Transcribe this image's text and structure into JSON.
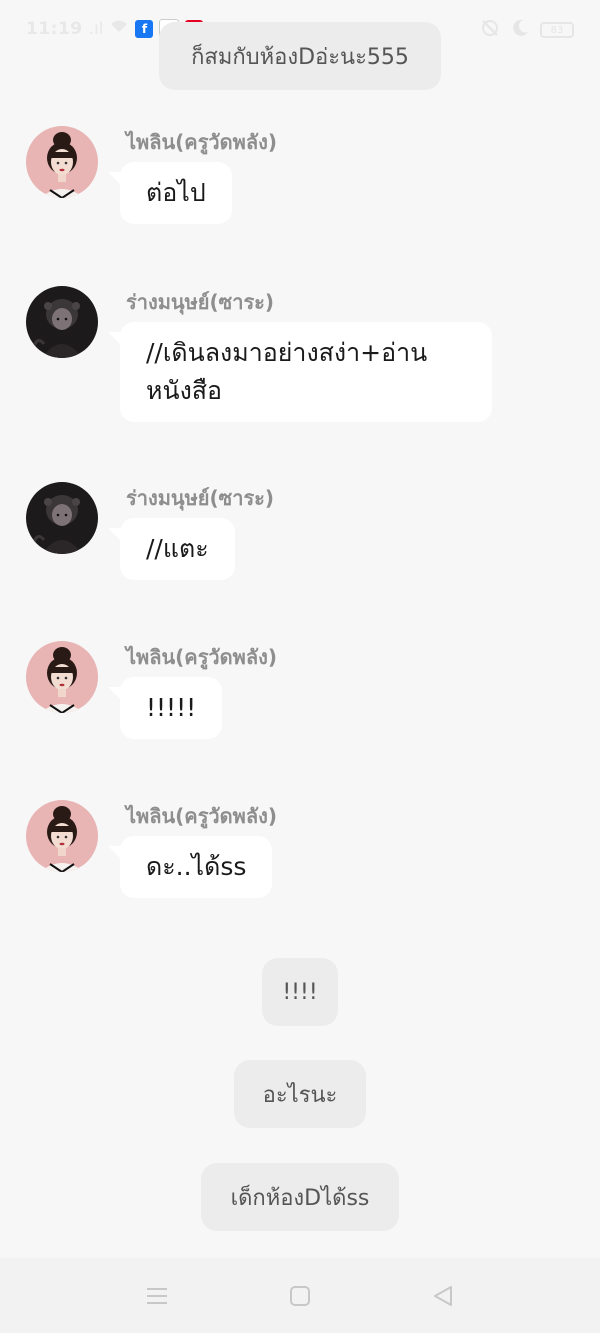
{
  "status_bar": {
    "time": "11:19",
    "signal": ".ıl",
    "apps": [
      {
        "name": "facebook-icon",
        "glyph": "f",
        "color": "#1877f2"
      },
      {
        "name": "line-icon",
        "glyph": "~",
        "color": "#ffffff"
      },
      {
        "name": "pinterest-icon",
        "glyph": "P",
        "color": "#e60023"
      }
    ],
    "more": "···",
    "battery": "83"
  },
  "chat": {
    "top_system_message": "ก็สมกับห้องDอ่ะนะ555",
    "messages": [
      {
        "sender": "ไพลิน(ครูวัดพลัง)",
        "avatar": "pailin-avatar",
        "lines": [
          "ต่อไป"
        ]
      },
      {
        "sender": "ร่างมนุษย์(ซาระ)",
        "avatar": "sara-avatar",
        "lines": [
          "//เดินลงมาอย่างสง่า+อ่าน",
          "หนังสือ"
        ]
      },
      {
        "sender": "ร่างมนุษย์(ซาระ)",
        "avatar": "sara-avatar",
        "lines": [
          "//แตะ"
        ]
      },
      {
        "sender": "ไพลิน(ครูวัดพลัง)",
        "avatar": "pailin-avatar",
        "lines": [
          "!!!!!"
        ]
      },
      {
        "sender": "ไพลิน(ครูวัดพลัง)",
        "avatar": "pailin-avatar",
        "lines": [
          "ดะ..ได้ss"
        ]
      }
    ],
    "system_messages": [
      "!!!!",
      "อะไรนะ",
      "เด็กห้องDได้ss"
    ]
  },
  "navbar": {
    "menu": "menu-icon",
    "home": "home-square-icon",
    "back": "back-triangle-icon"
  }
}
